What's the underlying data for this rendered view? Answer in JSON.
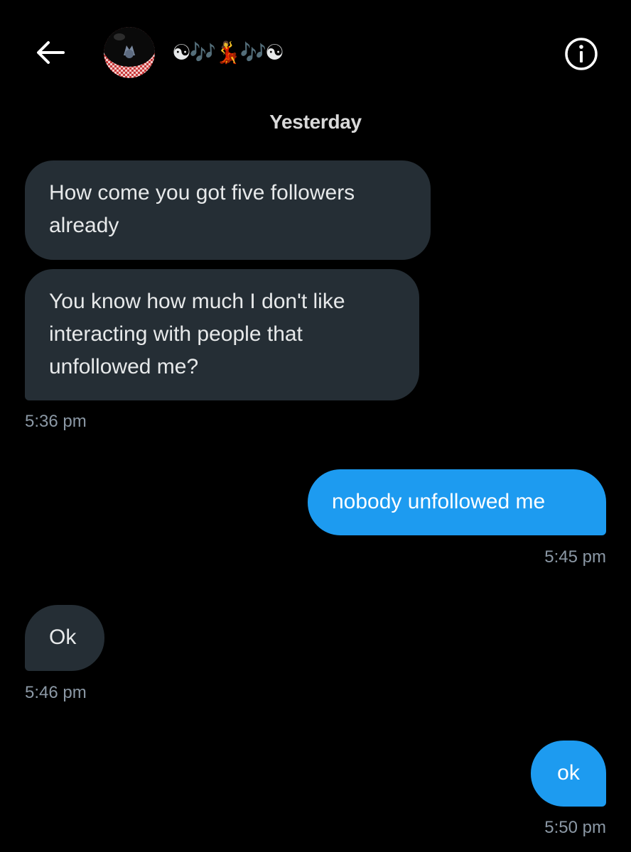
{
  "header": {
    "back_icon": "arrow-left-icon",
    "contact_name": "☯🎶💃🎶☯",
    "avatar_icon": "profile-avatar",
    "info_icon": "info-circle-icon"
  },
  "conversation": {
    "date_separator": "Yesterday",
    "messages": [
      {
        "direction": "received",
        "lines": [
          "How come you got five followers",
          "already"
        ]
      },
      {
        "direction": "received",
        "lines": [
          "You know how much I don't like",
          "interacting with people that",
          "unfollowed me?"
        ],
        "timestamp": "5:36 pm"
      },
      {
        "direction": "sent",
        "lines": [
          "nobody unfollowed me"
        ],
        "timestamp": "5:45 pm"
      },
      {
        "direction": "received",
        "lines": [
          "Ok"
        ],
        "timestamp": "5:46 pm"
      },
      {
        "direction": "sent",
        "lines": [
          "ok"
        ],
        "timestamp": "5:50 pm"
      }
    ]
  },
  "colors": {
    "background": "#000000",
    "received_bubble": "#252e35",
    "sent_bubble": "#1d9bf0",
    "timestamp": "#8b98a5"
  }
}
